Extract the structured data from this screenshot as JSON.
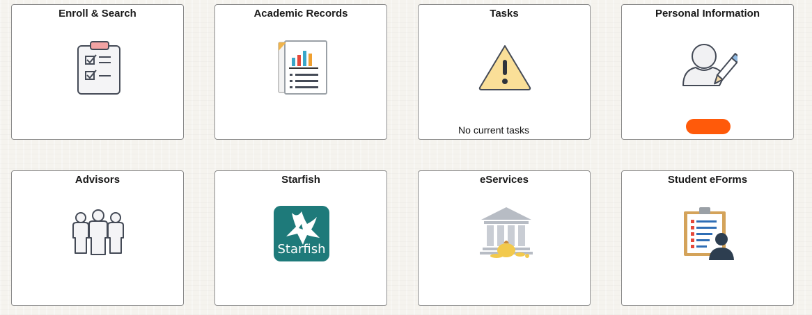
{
  "tiles": [
    {
      "title": "Enroll & Search",
      "icon": "clipboard-checklist-icon"
    },
    {
      "title": "Academic Records",
      "icon": "report-chart-icon"
    },
    {
      "title": "Tasks",
      "icon": "warning-icon",
      "status": "No current tasks"
    },
    {
      "title": "Personal Information",
      "icon": "user-edit-icon"
    },
    {
      "title": "Advisors",
      "icon": "people-group-icon"
    },
    {
      "title": "Starfish",
      "icon": "starfish-logo-icon",
      "logo_text": "Starfish"
    },
    {
      "title": "eServices",
      "icon": "bank-money-icon"
    },
    {
      "title": "Student eForms",
      "icon": "student-form-icon"
    }
  ],
  "colors": {
    "tile_border": "#8a8a8a",
    "redaction_mark": "#ff5a0a",
    "starfish_teal": "#1e7a7a",
    "warning_fill": "#fadf98"
  }
}
